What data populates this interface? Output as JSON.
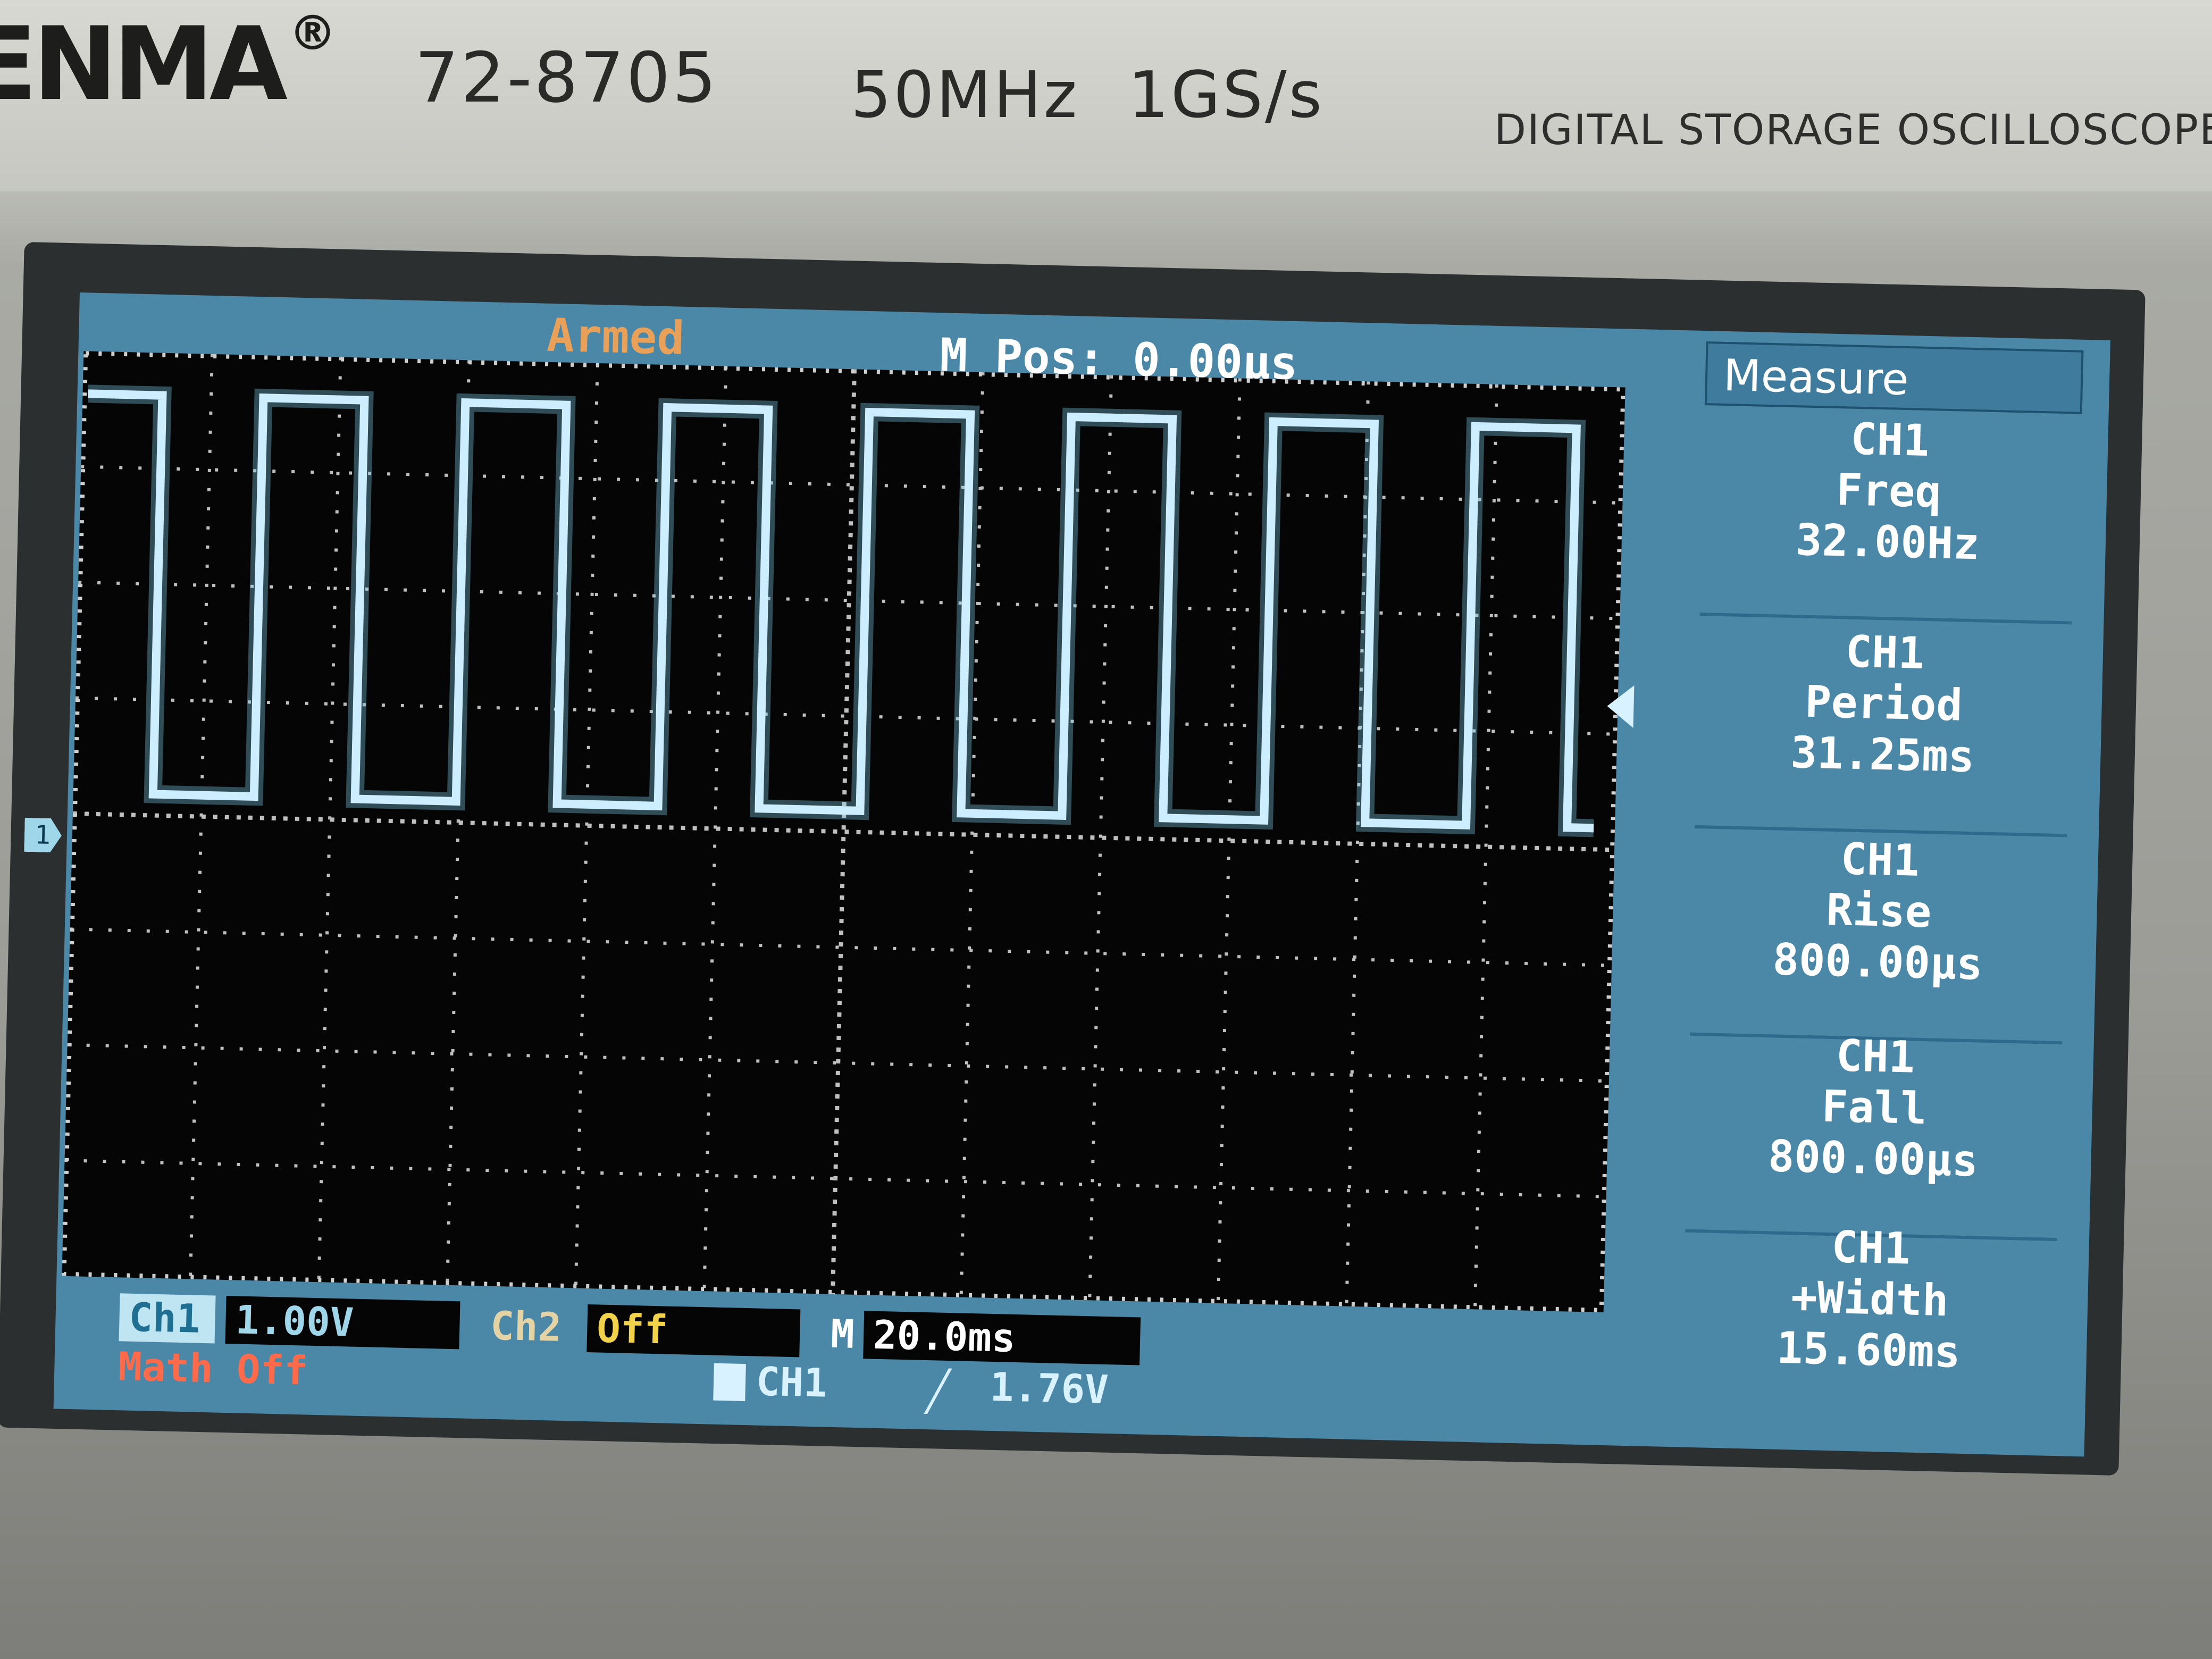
{
  "device": {
    "brand": "ENMA",
    "brand_mark": "®",
    "model": "72-8705",
    "specs": "50MHz  1GS/s",
    "type_label": "DIGITAL STORAGE OSCILLOSCOPE"
  },
  "screen": {
    "status": "Armed",
    "m_pos": "M Pos: 0.00µs",
    "ch1_marker": "1"
  },
  "measure": {
    "title": "Measure",
    "items": [
      {
        "ch": "CH1",
        "name": "Freq",
        "value": "32.00Hz"
      },
      {
        "ch": "CH1",
        "name": "Period",
        "value": "31.25ms"
      },
      {
        "ch": "CH1",
        "name": "Rise",
        "value": "800.00µs"
      },
      {
        "ch": "CH1",
        "name": "Fall",
        "value": "800.00µs"
      },
      {
        "ch": "CH1",
        "name": "+Width",
        "value": "15.60ms"
      }
    ]
  },
  "bottom_bar": {
    "ch1_label": "Ch1",
    "ch1_scale": "1.00V",
    "ch2_label": "Ch2",
    "ch2_value": "Off",
    "m_label": "M",
    "m_timebase": "20.0ms",
    "math": "Math Off",
    "trigger_source": "CH1",
    "trigger_edge_icon": "rising-edge-icon",
    "trigger_level": "1.76V"
  },
  "colors": {
    "lcd_bg": "#4b87a6",
    "graticule_bg": "#050505",
    "trace": "#cdeeff",
    "status_orange": "#e9a15a",
    "math_red": "#ff6a4a",
    "ch2_yellow": "#f2d24a"
  }
}
